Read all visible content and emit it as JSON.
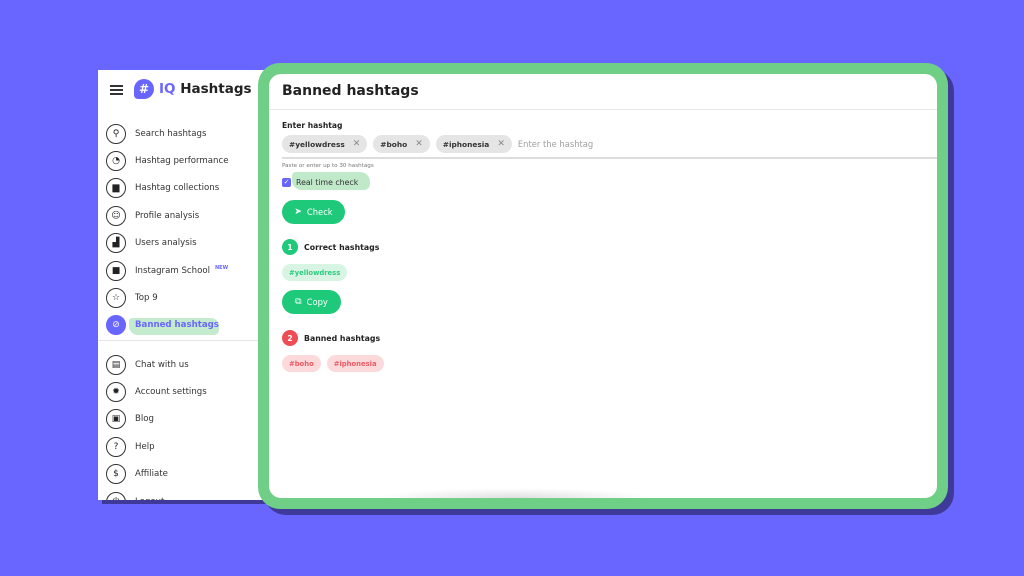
{
  "app": {
    "logo_prefix": "IQ",
    "logo_name": "Hashtags",
    "logo_badge": "#"
  },
  "sidebar": {
    "items": [
      {
        "label": "Search hashtags",
        "icon": "search-icon",
        "glyph": "⚲"
      },
      {
        "label": "Hashtag performance",
        "icon": "gauge-icon",
        "glyph": "◔"
      },
      {
        "label": "Hashtag collections",
        "icon": "folder-icon",
        "glyph": "▆"
      },
      {
        "label": "Profile analysis",
        "icon": "face-icon",
        "glyph": "☺"
      },
      {
        "label": "Users analysis",
        "icon": "chart-icon",
        "glyph": "▟"
      },
      {
        "label": "Instagram School",
        "icon": "school-icon",
        "glyph": "■",
        "badge": "NEW"
      },
      {
        "label": "Top 9",
        "icon": "star-icon",
        "glyph": "☆"
      },
      {
        "label": "Banned hashtags",
        "icon": "ban-icon",
        "glyph": "⊘",
        "active": true
      }
    ],
    "bottom_items": [
      {
        "label": "Chat with us",
        "icon": "chat-icon",
        "glyph": "▤"
      },
      {
        "label": "Account settings",
        "icon": "gear-icon",
        "glyph": "✹"
      },
      {
        "label": "Blog",
        "icon": "blog-icon",
        "glyph": "▣"
      },
      {
        "label": "Help",
        "icon": "help-icon",
        "glyph": "?"
      },
      {
        "label": "Affiliate",
        "icon": "dollar-icon",
        "glyph": "$"
      },
      {
        "label": "Logout",
        "icon": "power-icon",
        "glyph": "⏻"
      }
    ]
  },
  "main": {
    "title": "Banned hashtags",
    "field_label": "Enter hashtag",
    "entered_tags": [
      "#yellowdress",
      "#boho",
      "#iphonesia"
    ],
    "input_placeholder": "Enter the hashtag",
    "hint": "Paste or enter up to 30 hashtags",
    "realtime_check_label": "Real time check",
    "realtime_check_checked": true,
    "check_button": "Check",
    "correct_section": {
      "number": "1",
      "title": "Correct hashtags",
      "tags": [
        "#yellowdress"
      ]
    },
    "copy_button": "Copy",
    "banned_section": {
      "number": "2",
      "title": "Banned hashtags",
      "tags": [
        "#boho",
        "#iphonesia"
      ]
    }
  },
  "colors": {
    "background": "#6966ff",
    "frame": "#6fcf87",
    "accent": "#6966ff",
    "success": "#1ec97a",
    "danger": "#ef4d56"
  }
}
